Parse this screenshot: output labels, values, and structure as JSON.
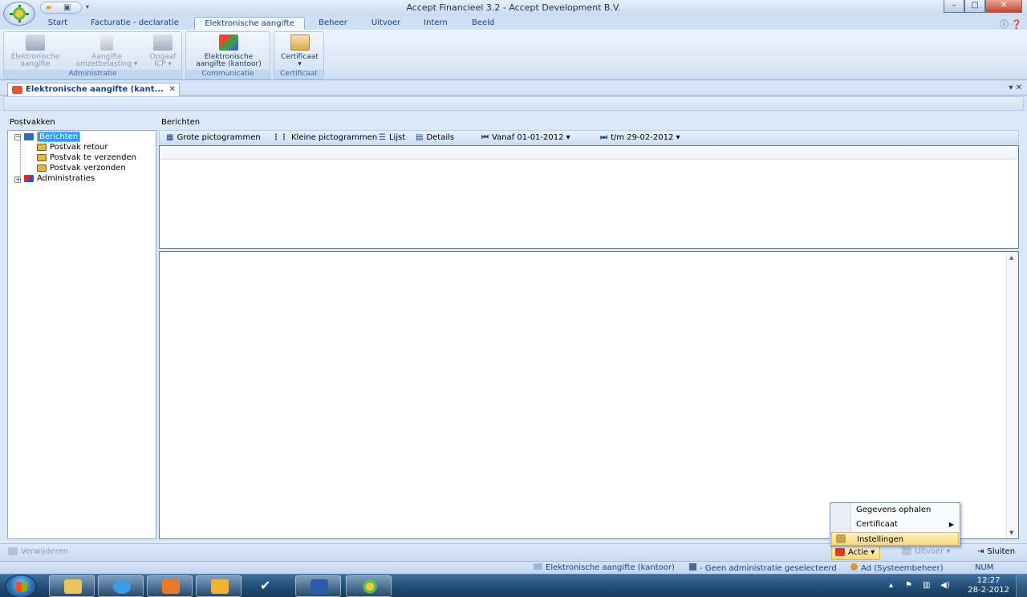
{
  "window": {
    "title": "Accept Financieel 3.2 - Accept Development B.V.",
    "buttons": {
      "minimize": "–",
      "maximize": "□",
      "close": "✕"
    }
  },
  "quick_access": {
    "open_icon": "folder-open-icon",
    "print_icon": "printer-icon",
    "dropdown": "▾"
  },
  "ribbon": {
    "tabs": [
      "Start",
      "Facturatie - declaratie",
      "Elektronische aangifte",
      "Beheer",
      "Uitvoer",
      "Intern",
      "Beeld"
    ],
    "active_tab": "Elektronische aangifte",
    "groups": [
      {
        "label": "Administratie",
        "buttons": [
          {
            "line1": "Elektronische",
            "line2": "aangifte",
            "icon": "computer-icon",
            "enabled": false
          },
          {
            "line1": "Aangifte",
            "line2": "omzetbelasting ▾",
            "icon": "document-icon",
            "enabled": false
          },
          {
            "line1": "Opgaaf",
            "line2": "ICP ▾",
            "icon": "truck-icon",
            "enabled": false
          }
        ]
      },
      {
        "label": "Communicatie",
        "buttons": [
          {
            "line1": "Elektronische",
            "line2": "aangifte (kantoor)",
            "icon": "envelope-icon",
            "enabled": true
          }
        ]
      },
      {
        "label": "Certificaat",
        "buttons": [
          {
            "line1": "Certificaat",
            "line2": "▾",
            "icon": "certificate-icon",
            "enabled": true
          }
        ]
      }
    ]
  },
  "document_tab": {
    "label": "Elektronische aangifte (kant...",
    "close": "✕",
    "right_controls": "▾ ✕"
  },
  "left_pane": {
    "caption": "Postvakken",
    "tree": [
      {
        "label": "Berichten",
        "level": 0,
        "expander": "−",
        "selected": true,
        "icon": "folder-tree-icon"
      },
      {
        "label": "Postvak retour",
        "level": 1,
        "icon": "inbox-icon"
      },
      {
        "label": "Postvak te verzenden",
        "level": 1,
        "icon": "inbox-icon"
      },
      {
        "label": "Postvak verzonden",
        "level": 1,
        "icon": "inbox-icon"
      },
      {
        "label": "Administraties",
        "level": 0,
        "expander": "+",
        "icon": "administration-icon"
      }
    ]
  },
  "right_pane": {
    "caption": "Berichten",
    "view_toolbar": {
      "large_icons": "Grote pictogrammen",
      "small_icons": "Kleine pictogrammen",
      "list": "Lijst",
      "details": "Details",
      "from_label": "Vanaf 01-01-2012",
      "to_label": "t/m 29-02-2012"
    }
  },
  "command_bar": {
    "delete": "Verwijderen",
    "action": "Actie",
    "export": "Uitvoer",
    "close": "Sluiten"
  },
  "action_menu": {
    "items": [
      {
        "label": "Gegevens ophalen",
        "submenu": false,
        "highlighted": false
      },
      {
        "label": "Certificaat",
        "submenu": true,
        "highlighted": false
      },
      {
        "label": "Instellingen",
        "submenu": false,
        "highlighted": true
      }
    ]
  },
  "status_bar": {
    "module": "Elektronische aangifte (kantoor)",
    "administration": "- Geen administratie geselecteerd",
    "user": "Ad (Systeembeheer)",
    "num": "NUM"
  },
  "taskbar": {
    "apps": [
      "explorer-icon",
      "internet-explorer-icon",
      "media-player-icon",
      "outlook-icon",
      "ticker-icon",
      "word-icon",
      "accept-financieel-icon"
    ],
    "clock_time": "12:27",
    "clock_date": "28-2-2012"
  },
  "colors": {
    "ribbon_bg": "#dce8f7",
    "selection": "#3399ff",
    "menu_highlight": "#fcd97e",
    "taskbar": "#1f4b73"
  }
}
